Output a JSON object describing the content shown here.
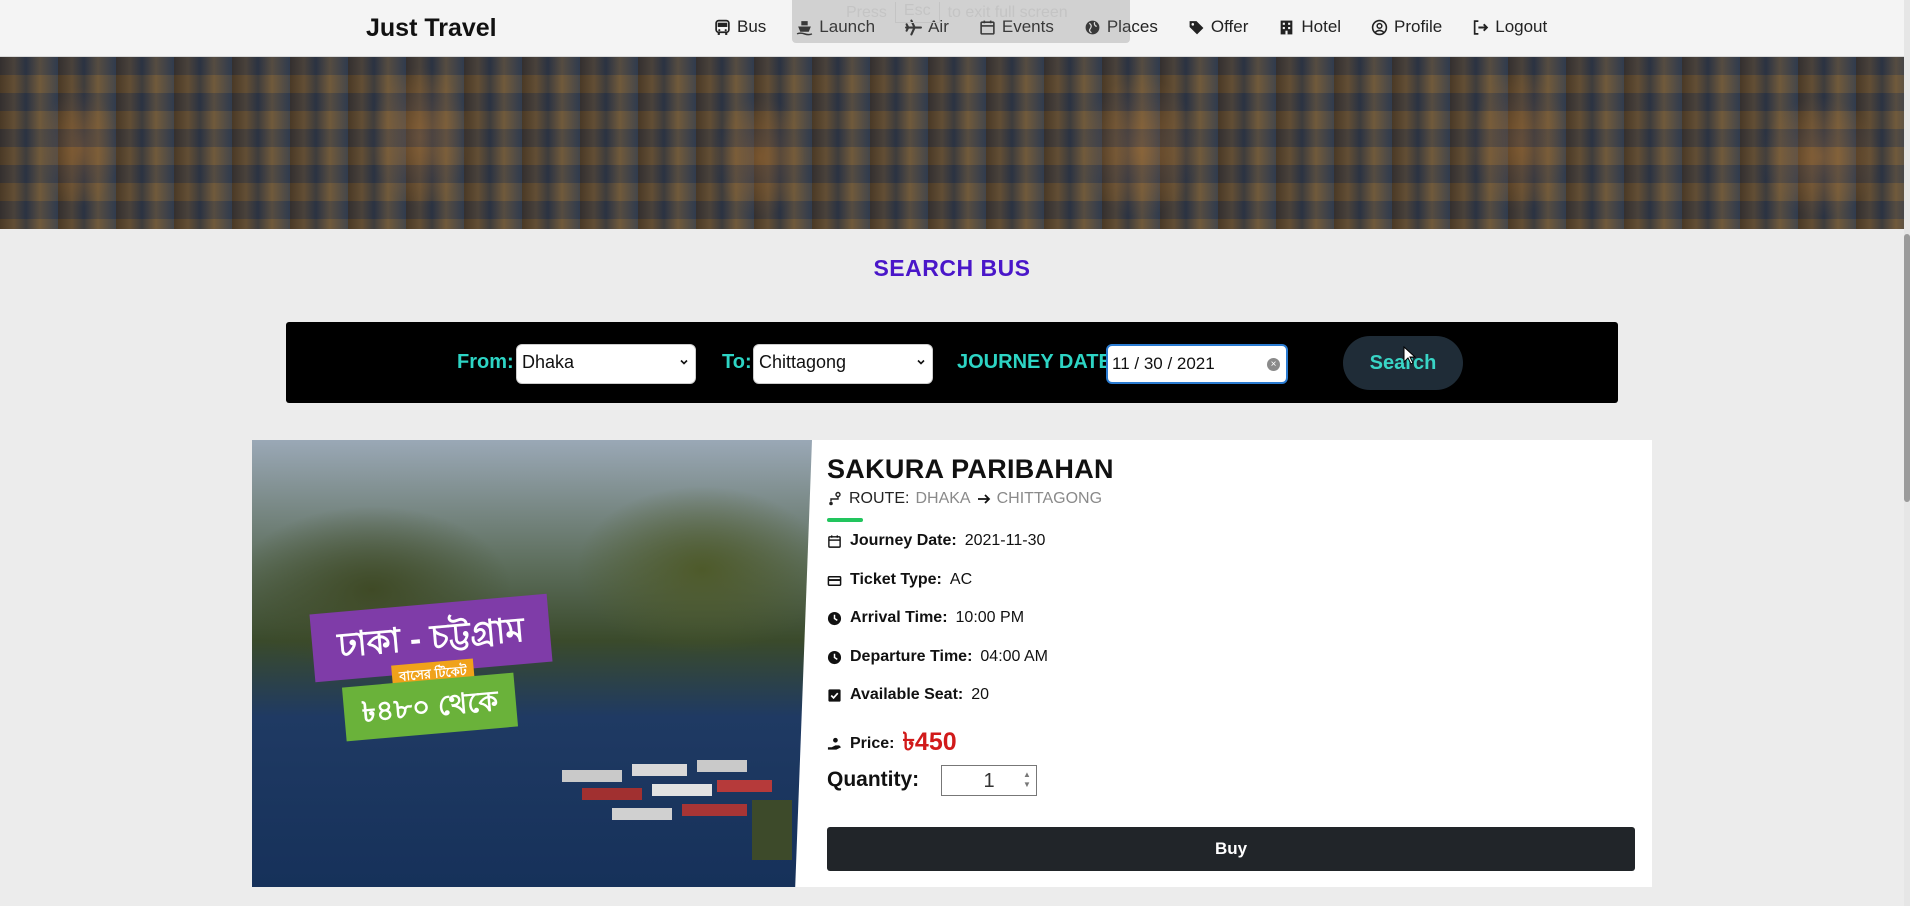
{
  "brand": "Just Travel",
  "nav": [
    {
      "label": "Bus",
      "icon": "bus-icon"
    },
    {
      "label": "Launch",
      "icon": "ship-icon"
    },
    {
      "label": "Air",
      "icon": "plane-icon"
    },
    {
      "label": "Events",
      "icon": "calendar-icon"
    },
    {
      "label": "Places",
      "icon": "globe-icon"
    },
    {
      "label": "Offer",
      "icon": "tag-icon"
    },
    {
      "label": "Hotel",
      "icon": "building-icon"
    },
    {
      "label": "Profile",
      "icon": "user-circle-icon"
    },
    {
      "label": "Logout",
      "icon": "logout-icon"
    }
  ],
  "fullscreen_notice": {
    "press": "Press",
    "key": "Esc",
    "rest": "to exit full screen"
  },
  "search": {
    "title": "SEARCH BUS",
    "from_label": "From:",
    "from_value": "Dhaka",
    "to_label": "To:",
    "to_value": "Chittagong",
    "date_label": "JOURNEY DATE:",
    "date_value": "11 / 30 / 2021",
    "button": "Search"
  },
  "result": {
    "operator": "SAKURA PARIBAHAN",
    "route_label": "ROUTE:",
    "route_from": "DHAKA",
    "route_to": "CHITTAGONG",
    "journey_date_label": "Journey Date:",
    "journey_date": "2021-11-30",
    "ticket_type_label": "Ticket Type:",
    "ticket_type": "AC",
    "arrival_label": "Arrival Time:",
    "arrival": "10:00 PM",
    "departure_label": "Departure Time:",
    "departure": "04:00 AM",
    "seat_label": "Available Seat:",
    "seat": "20",
    "price_label": "Price:",
    "price": "৳450",
    "quantity_label": "Quantity:",
    "quantity": "1",
    "buy": "Buy",
    "image_text": {
      "line1": "ঢাকা - চট্টগ্রাম",
      "line2": "বাসের টিকেট",
      "line3": "৳৪৮০ থেকে"
    }
  },
  "colors": {
    "accent_title": "#4a16c9",
    "label_teal": "#2dd4c4",
    "price_red": "#d11a1a",
    "route_underline": "#22c55e"
  }
}
